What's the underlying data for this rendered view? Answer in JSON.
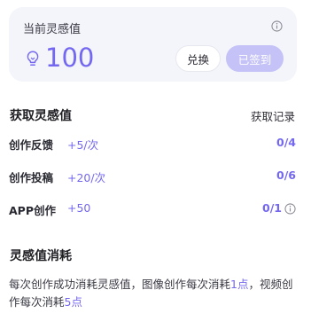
{
  "balance_card": {
    "title": "当前灵感值",
    "amount": "100",
    "exchange_label": "兑换",
    "signed_label": "已签到"
  },
  "earn_section": {
    "title": "获取灵感值",
    "record_link": "获取记录",
    "items": [
      {
        "name": "创作反馈",
        "reward": "+5/次",
        "progress": "0/4"
      },
      {
        "name": "创作投稿",
        "reward": "+20/次",
        "progress": "0/6"
      },
      {
        "name": "APP创作",
        "reward": "+50",
        "progress": "0/1"
      }
    ]
  },
  "consume_section": {
    "title": "灵感值消耗",
    "text_part1": "每次创作成功消耗灵感值，图像创作每次消耗",
    "highlight1": "1点",
    "text_part2": "，视频创作每次消耗",
    "highlight2": "5点"
  },
  "colors": {
    "accent": "#7468f0",
    "card_bg": "#f4f5fb",
    "signed_bg": "#c4c2f6"
  },
  "icons": [
    "info-icon",
    "lightbulb-icon"
  ]
}
